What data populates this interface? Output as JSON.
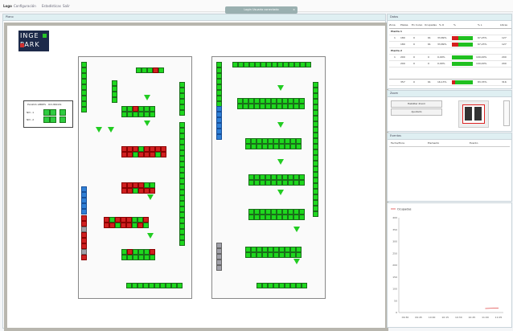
{
  "menu": [
    "Logo",
    "Configuración",
    "Estadísticas",
    "Salir"
  ],
  "login_bar": {
    "text": "Login",
    "subtext": "Usuario conectado",
    "close": "×"
  },
  "plano": {
    "title": "Plano"
  },
  "logo": {
    "line1": "INGE",
    "line2": "PARK"
  },
  "legend": {
    "title": "PLAZAS LIBRES · OCUPADAS",
    "row1": "NIV -1",
    "row2": "NIV -2"
  },
  "datos": {
    "title": "Datos",
    "columns": [
      "Zona",
      "Plazas",
      "En Curso",
      "Ocupadas",
      "% O",
      "%",
      "% L",
      "Libres"
    ],
    "groups": [
      {
        "name": "Planta 1",
        "rows": [
          [
            "1",
            "180",
            "0",
            "61",
            "33,89%",
            "",
            "67,23%",
            "127"
          ],
          [
            "",
            "180",
            "0",
            "61",
            "33,89%",
            "",
            "67,23%",
            "127"
          ]
        ]
      },
      {
        "name": "Planta 2",
        "rows": [
          [
            "1",
            "200",
            "0",
            "0",
            "0,00%",
            "",
            "100,00%",
            "200"
          ],
          [
            "",
            "200",
            "0",
            "0",
            "0,00%",
            "",
            "100,00%",
            "200"
          ]
        ]
      }
    ],
    "total": [
      "",
      "357",
      "0",
      "61",
      "16,13%",
      "",
      "83,33%",
      "316"
    ]
  },
  "zoom": {
    "title": "Zoom",
    "btn1": "Habilitar Zoom",
    "btn2": "Ajustado"
  },
  "eventos": {
    "title": "Eventos",
    "columns": [
      "Fecha/Hora",
      "Elemento",
      "Evento"
    ]
  },
  "chart_data": {
    "type": "line",
    "title": "",
    "legend": [
      "Ocupadas"
    ],
    "series": [
      {
        "name": "Ocupadas",
        "values": [
          null,
          null,
          null,
          null,
          null,
          null,
          17,
          19
        ]
      }
    ],
    "categories": [
      "09:30",
      "09:45",
      "10:00",
      "10:15",
      "10:30",
      "10:45",
      "11:00",
      "11:05"
    ],
    "y_ticks": [
      "400",
      "350",
      "300",
      "250",
      "200",
      "150",
      "100",
      "50",
      "0"
    ],
    "ylim": [
      0,
      400
    ],
    "grid": false,
    "legend_position": "top-left",
    "color": "#e04848"
  }
}
